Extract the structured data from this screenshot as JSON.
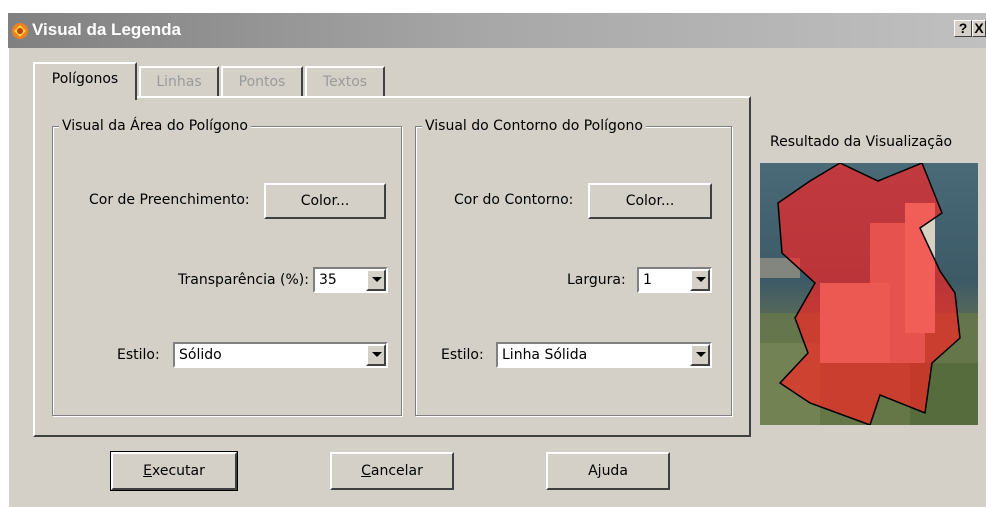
{
  "window": {
    "title": "Visual da Legenda",
    "help_btn": "?",
    "close_btn": "X"
  },
  "tabs": [
    {
      "label": "Polígonos",
      "active": true
    },
    {
      "label": "Linhas",
      "active": false
    },
    {
      "label": "Pontos",
      "active": false
    },
    {
      "label": "Textos",
      "active": false
    }
  ],
  "area_group": {
    "title": "Visual da Área do Polígono",
    "fill_label": "Cor de Preenchimento:",
    "fill_button": "Color...",
    "transparency_label": "Transparência (%):",
    "transparency_value": "35",
    "style_label": "Estilo:",
    "style_value": "Sólido"
  },
  "outline_group": {
    "title": "Visual do Contorno do Polígono",
    "color_label": "Cor do Contorno:",
    "color_button": "Color...",
    "width_label": "Largura:",
    "width_value": "1",
    "style_label": "Estilo:",
    "style_value": "Linha Sólida"
  },
  "preview": {
    "label": "Resultado da Visualização",
    "fill_color": "#ff2020",
    "fill_opacity": 0.65
  },
  "buttons": {
    "execute_pre": "",
    "execute_ul": "E",
    "execute_post": "xecutar",
    "cancel_pre": "",
    "cancel_ul": "C",
    "cancel_post": "ancelar",
    "help_pre": "A",
    "help_ul": "j",
    "help_post": "uda"
  }
}
